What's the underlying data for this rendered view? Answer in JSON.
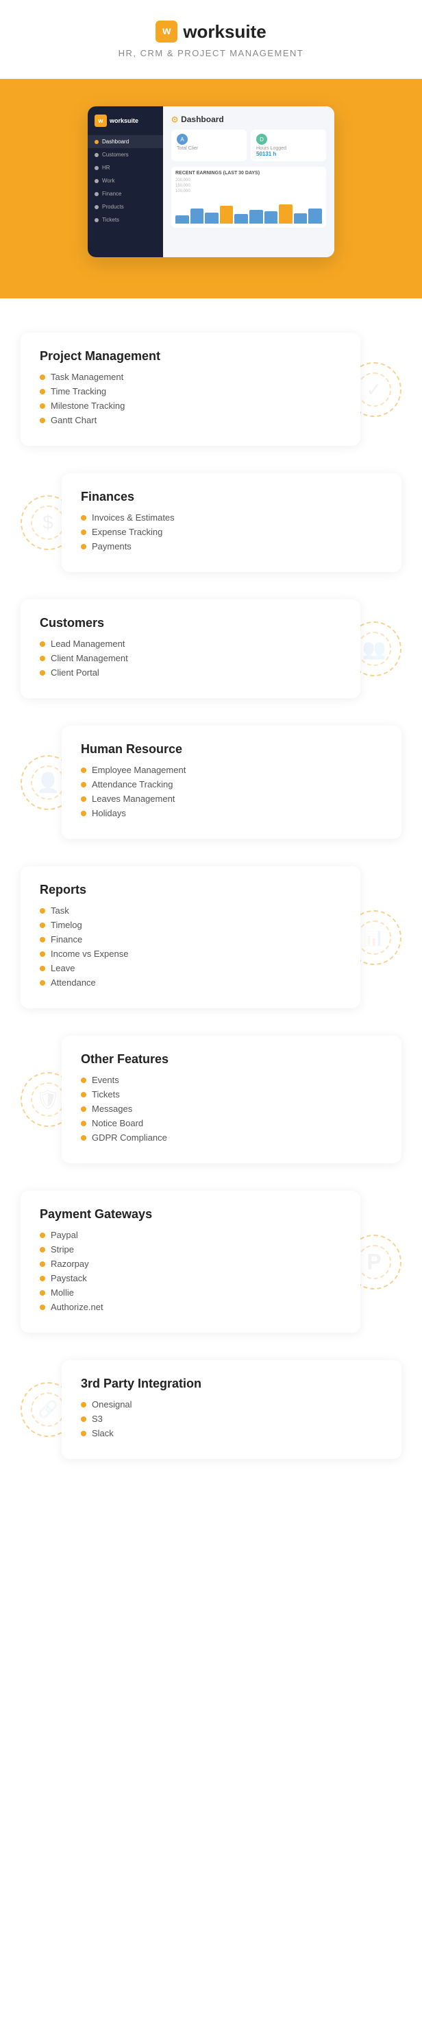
{
  "header": {
    "logo_icon": "w",
    "logo_name": "worksuite",
    "tagline": "HR, CRM & PROJECT MANAGEMENT"
  },
  "sidebar": {
    "logo_icon": "w",
    "logo_name": "worksuite",
    "items": [
      {
        "label": "Dashboard",
        "active": true,
        "icon": "grid"
      },
      {
        "label": "Customers",
        "active": false,
        "icon": "users"
      },
      {
        "label": "HR",
        "active": false,
        "icon": "person"
      },
      {
        "label": "Work",
        "active": false,
        "icon": "briefcase"
      },
      {
        "label": "Finance",
        "active": false,
        "icon": "dollar"
      },
      {
        "label": "Products",
        "active": false,
        "icon": "box"
      },
      {
        "label": "Tickets",
        "active": false,
        "icon": "ticket"
      }
    ]
  },
  "dashboard": {
    "title": "Dashboard",
    "total_clients_label": "Total Clier",
    "stat1": {
      "icon": "A",
      "label": "Total Clier"
    },
    "stat2": {
      "icon": "D",
      "label": "Hours Logged",
      "value": "50131 h"
    },
    "earnings": {
      "title": "RECENT EARNINGS (LAST 30 DAYS)",
      "y_labels": [
        "200,000",
        "150,000",
        "100,000"
      ],
      "bars": [
        30,
        55,
        40,
        65,
        35,
        50,
        45,
        70,
        38,
        55
      ]
    }
  },
  "features": [
    {
      "id": "project-management",
      "title": "Project Management",
      "align": "left",
      "items": [
        "Task Management",
        "Time Tracking",
        "Milestone Tracking",
        "Gantt Chart"
      ],
      "deco_icon": "✓"
    },
    {
      "id": "finances",
      "title": "Finances",
      "align": "right",
      "items": [
        "Invoices & Estimates",
        "Expense Tracking",
        "Payments"
      ],
      "deco_icon": "$"
    },
    {
      "id": "customers",
      "title": "Customers",
      "align": "left",
      "items": [
        "Lead Management",
        "Client Management",
        "Client Portal"
      ],
      "deco_icon": "👥"
    },
    {
      "id": "human-resource",
      "title": "Human Resource",
      "align": "right",
      "items": [
        "Employee Management",
        "Attendance Tracking",
        "Leaves Management",
        "Holidays"
      ],
      "deco_icon": "👤"
    },
    {
      "id": "reports",
      "title": "Reports",
      "align": "left",
      "items": [
        "Task",
        "Timelog",
        "Finance",
        "Income vs Expense",
        "Leave",
        "Attendance"
      ],
      "deco_icon": "📊"
    },
    {
      "id": "other-features",
      "title": "Other Features",
      "align": "right",
      "items": [
        "Events",
        "Tickets",
        "Messages",
        "Notice Board",
        "GDPR Compliance"
      ],
      "deco_icon": "🛡"
    },
    {
      "id": "payment-gateways",
      "title": "Payment Gateways",
      "align": "left",
      "items": [
        "Paypal",
        "Stripe",
        "Razorpay",
        "Paystack",
        "Mollie",
        "Authorize.net"
      ],
      "deco_icon": "P"
    },
    {
      "id": "third-party",
      "title": "3rd Party Integration",
      "align": "right",
      "items": [
        "Onesignal",
        "S3",
        "Slack"
      ],
      "deco_icon": "🔗"
    }
  ]
}
